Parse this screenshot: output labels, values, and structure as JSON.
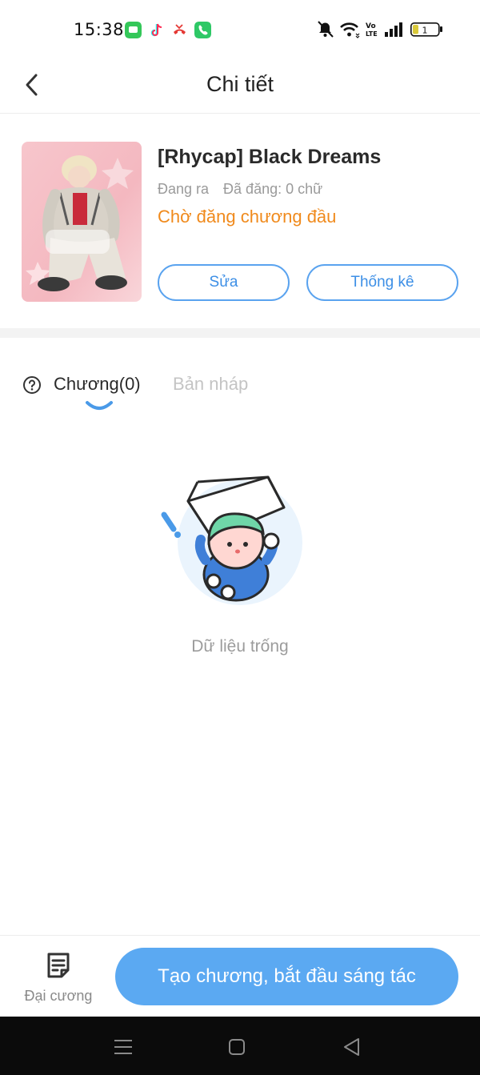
{
  "status_bar": {
    "time": "15:38",
    "app_icons": [
      "message-icon",
      "tiktok-icon",
      "missed-call-icon",
      "phone-icon"
    ],
    "system_icons": [
      "mute-icon",
      "wifi-icon",
      "volte-icon",
      "signal-icon",
      "battery-icon"
    ],
    "volte_label": "Vo LTE",
    "battery_level": "1"
  },
  "header": {
    "title": "Chi tiết"
  },
  "book": {
    "title": "[Rhycap] Black Dreams",
    "state": "Đang ra",
    "published": "Đã đăng: 0 chữ",
    "status": "Chờ đăng chương đầu",
    "edit_label": "Sửa",
    "stats_label": "Thống kê"
  },
  "tabs": {
    "chapters_label": "Chương(0)",
    "drafts_label": "Bản nháp"
  },
  "empty_state": {
    "text": "Dữ liệu trống"
  },
  "bottom_bar": {
    "outline_label": "Đại cương",
    "create_label": "Tạo chương, bắt đầu sáng tác"
  },
  "colors": {
    "accent": "#5ba9f2",
    "accent_border": "#5aa3ef",
    "status_orange": "#f08a1c",
    "muted_text": "#9a9a9a"
  }
}
